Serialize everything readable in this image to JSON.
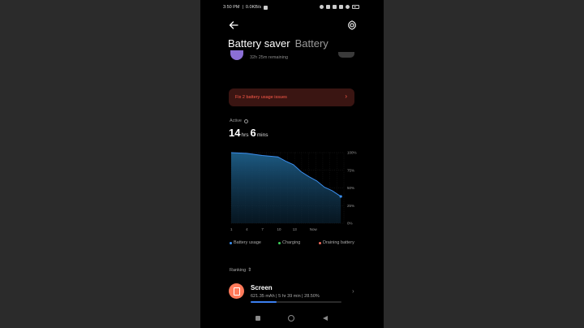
{
  "status_bar": {
    "time": "3:50 PM",
    "network_speed": "0.0KB/s"
  },
  "header": {
    "title": "Battery saver",
    "secondary_title": "Battery"
  },
  "battery_saver": {
    "remaining": "32h 25m remaining"
  },
  "alert": {
    "text": "Fix 2 battery usage issues",
    "chevron": "›"
  },
  "active": {
    "label": "Active",
    "hours": "14",
    "hours_unit": "hrs",
    "minutes": "6",
    "minutes_unit": "mins"
  },
  "chart_data": {
    "type": "area",
    "x_tick_labels": [
      "1",
      "4",
      "7",
      "10",
      "13",
      "Now"
    ],
    "y_tick_labels": [
      "100%",
      "75%",
      "50%",
      "25%",
      "0%"
    ],
    "ylim": [
      0,
      100
    ],
    "x": [
      0,
      2,
      4,
      6,
      7,
      8,
      9,
      10,
      11,
      12,
      13,
      14.1
    ],
    "series": [
      {
        "name": "Battery usage",
        "values": [
          100,
          99,
          96,
          94,
          88,
          83,
          73,
          66,
          60,
          51,
          46,
          38
        ]
      }
    ],
    "accent_color": "#3b8ff0"
  },
  "legend": {
    "items": [
      {
        "label": "Battery usage",
        "color": "#3b8ff0"
      },
      {
        "label": "Charging",
        "color": "#3ecf5a"
      },
      {
        "label": "Draining battery",
        "color": "#f06a5a"
      }
    ]
  },
  "ranking": {
    "label": "Ranking",
    "sort_icon": "⇕"
  },
  "usage_items": [
    {
      "title": "Screen",
      "meta": "621.35 mAh | 5 hr 39 min | 28.50%",
      "percent": 28.5,
      "icon": "screen-icon",
      "color": "#ff7a5a"
    }
  ]
}
